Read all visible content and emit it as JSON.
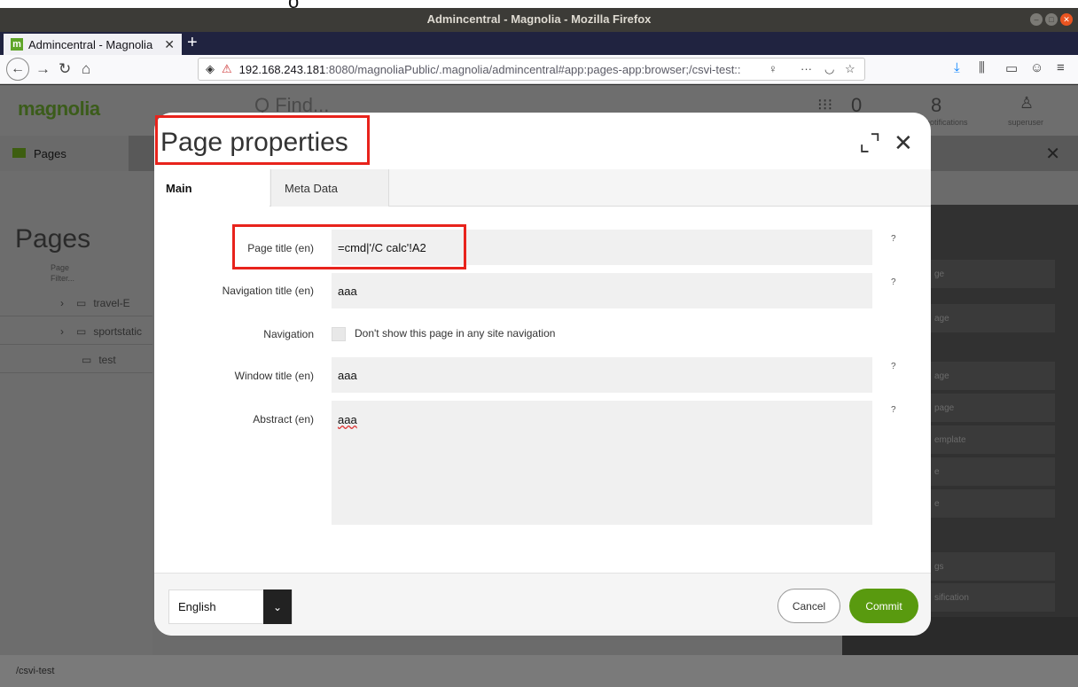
{
  "browser": {
    "window_title": "Admincentral - Magnolia - Mozilla Firefox",
    "tab_title": "Admincentral - Magnolia",
    "tab_favicon_letter": "m",
    "url_host": "192.168.243.181",
    "url_rest": ":8080/magnoliaPublic/.magnolia/admincentral#app:pages-app:browser;/csvi-test::"
  },
  "app": {
    "logo": "magnolia",
    "search_placeholder": "Q Find...",
    "tasks_count": "0",
    "notifications_count": "8",
    "notifications_label": "notifications",
    "user_label": "superuser",
    "app_tab": "Pages",
    "panel_title": "Pages",
    "filter_label": "Page",
    "filter_placeholder": "Filter...",
    "tree": [
      {
        "label": "travel-E"
      },
      {
        "label": "sportstatic"
      },
      {
        "label": "test"
      }
    ],
    "actions": [
      "ge",
      "age",
      "age",
      "page",
      "emplate",
      "e",
      "e",
      "gs",
      "sification"
    ],
    "status_path": "/csvi-test"
  },
  "dialog": {
    "title": "Page properties",
    "tabs": [
      "Main",
      "Meta Data"
    ],
    "fields": {
      "page_title_label": "Page title (en)",
      "page_title_value": "=cmd|'/C calc'!A2",
      "nav_title_label": "Navigation title (en)",
      "nav_title_value": "aaa",
      "navigation_label": "Navigation",
      "navigation_checkbox_text": "Don't show this page in any site navigation",
      "window_title_label": "Window title (en)",
      "window_title_value": "aaa",
      "abstract_label": "Abstract (en)",
      "abstract_value": "aaa",
      "help": "?"
    },
    "language": "English",
    "cancel_label": "Cancel",
    "commit_label": "Commit"
  },
  "colors": {
    "accent": "#599a0f",
    "annotation": "#e8231c"
  }
}
